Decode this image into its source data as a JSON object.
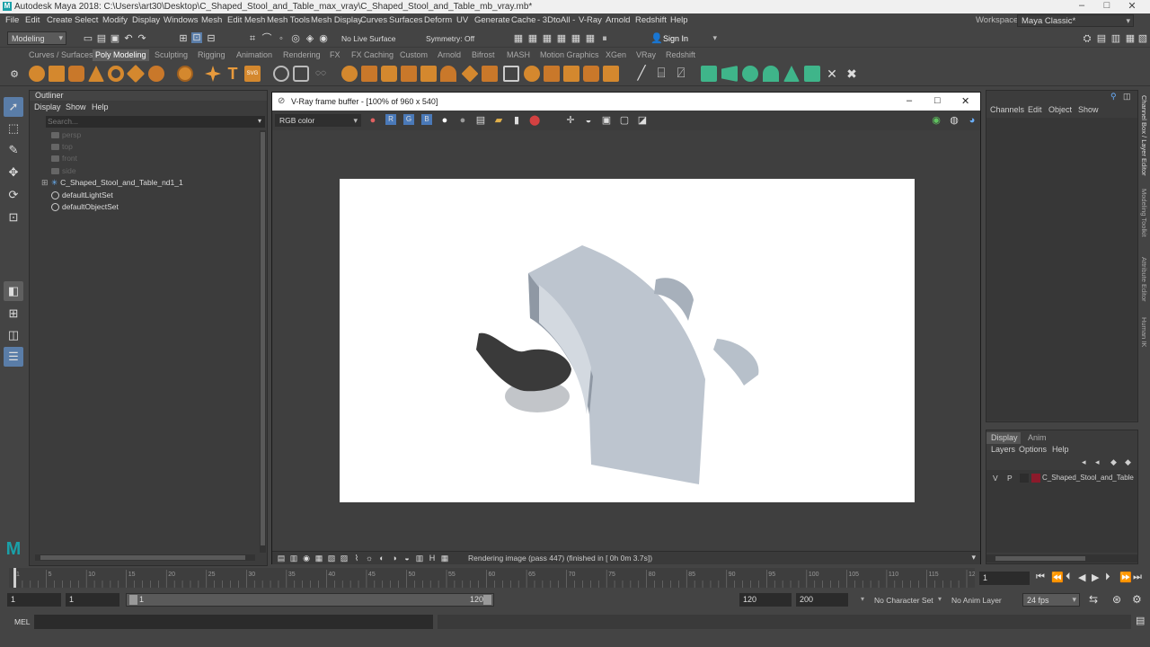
{
  "window": {
    "title": "Autodesk Maya 2018: C:\\Users\\art30\\Desktop\\C_Shaped_Stool_and_Table_max_vray\\C_Shaped_Stool_and_Table_mb_vray.mb*",
    "workspace_label": "Workspace :",
    "workspace_value": "Maya Classic*"
  },
  "menu": [
    "File",
    "Edit",
    "Create",
    "Select",
    "Modify",
    "Display",
    "Windows",
    "Mesh",
    "Edit Mesh",
    "Mesh Tools",
    "Mesh Display",
    "Curves",
    "Surfaces",
    "Deform",
    "UV",
    "Generate",
    "Cache",
    "- 3DtoAll -",
    "V-Ray",
    "Arnold",
    "Redshift",
    "Help"
  ],
  "status": {
    "mode": "Modeling",
    "live_surface": "No Live Surface",
    "symmetry": "Symmetry: Off",
    "sign_in": "Sign In"
  },
  "shelf_tabs": [
    "Curves / Surfaces",
    "Poly Modeling",
    "Sculpting",
    "Rigging",
    "Animation",
    "Rendering",
    "FX",
    "FX Caching",
    "Custom",
    "Arnold",
    "Bifrost",
    "MASH",
    "Motion Graphics",
    "XGen",
    "VRay",
    "Redshift"
  ],
  "shelf_active": "Poly Modeling",
  "outliner": {
    "title": "Outliner",
    "menu": [
      "Display",
      "Show",
      "Help"
    ],
    "search_placeholder": "Search...",
    "items": [
      {
        "label": "persp",
        "dim": true
      },
      {
        "label": "top",
        "dim": true
      },
      {
        "label": "front",
        "dim": true
      },
      {
        "label": "side",
        "dim": true
      },
      {
        "label": "C_Shaped_Stool_and_Table_nd1_1",
        "dim": false
      },
      {
        "label": "defaultLightSet",
        "dim": false
      },
      {
        "label": "defaultObjectSet",
        "dim": false
      }
    ]
  },
  "vfb": {
    "title": "V-Ray frame buffer - [100% of 960 x 540]",
    "channel": "RGB color",
    "status_text": "Rendering image (pass 447) (finished in [ 0h  0m  3.7s])"
  },
  "channel_box": {
    "menu": [
      "Channels",
      "Edit",
      "Object",
      "Show"
    ]
  },
  "layer_editor": {
    "tabs": [
      "Display",
      "Anim"
    ],
    "menu": [
      "Layers",
      "Options",
      "Help"
    ],
    "layer": {
      "v": "V",
      "p": "P",
      "name": "C_Shaped_Stool_and_Table",
      "color": "#8b1a2b"
    }
  },
  "side_tabs": [
    "Channel Box / Layer Editor",
    "Modeling Toolkit",
    "Attribute Editor",
    "Human IK"
  ],
  "timeline": {
    "ticks": [
      "1",
      "5",
      "10",
      "15",
      "20",
      "25",
      "30",
      "35",
      "40",
      "45",
      "50",
      "55",
      "60",
      "65",
      "70",
      "75",
      "80",
      "85",
      "90",
      "95",
      "100",
      "105",
      "110",
      "115",
      "120"
    ],
    "current_frame": "1"
  },
  "range": {
    "start": "1",
    "playback_start": "1",
    "slider_start": "1",
    "slider_end": "120",
    "playback_end": "120",
    "end": "200",
    "character_set": "No Character Set",
    "anim_layer": "No Anim Layer",
    "fps": "24 fps"
  },
  "command": {
    "label": "MEL"
  }
}
